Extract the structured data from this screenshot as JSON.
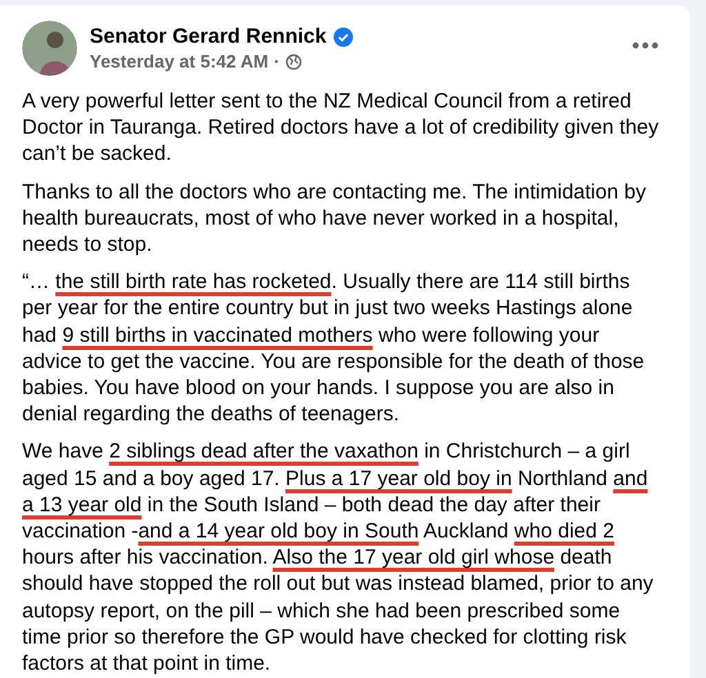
{
  "post": {
    "author": "Senator Gerard Rennick",
    "verified": true,
    "time": "Yesterday at 5:42 AM",
    "separator": "·",
    "paragraphs": [
      [
        {
          "text": "A very powerful letter sent to the NZ Medical Council from a retired Doctor in Tauranga. Retired doctors have a lot of credibility given they can’t be sacked.",
          "underlined": false
        }
      ],
      [
        {
          "text": "Thanks to all the doctors who are contacting me. The intimidation by health bureaucrats, most of who have never worked in a hospital, needs to stop.",
          "underlined": false
        }
      ],
      [
        {
          "text": "“… ",
          "underlined": false
        },
        {
          "text": "the still birth rate has rocketed",
          "underlined": true
        },
        {
          "text": ". Usually there are 114 still births per year for the entire country but in just two weeks Hastings alone had ",
          "underlined": false
        },
        {
          "text": "9 still births in vaccinated mothers",
          "underlined": true
        },
        {
          "text": " who were following your advice to get the vaccine. You are responsible for the death of those babies. You have blood on your hands. I suppose you are also in denial regarding the deaths of teenagers.",
          "underlined": false
        }
      ],
      [
        {
          "text": "We have ",
          "underlined": false
        },
        {
          "text": "2 siblings dead after the vaxathon",
          "underlined": true
        },
        {
          "text": " in Christchurch – a girl aged 15 and a boy aged 17. ",
          "underlined": false
        },
        {
          "text": "Plus a 17 year old boy in",
          "underlined": true
        },
        {
          "text": " Northland ",
          "underlined": false
        },
        {
          "text": "and a 13 year old",
          "underlined": true
        },
        {
          "text": " in the South Island – both dead the day after their vaccination -",
          "underlined": false
        },
        {
          "text": "and a 14 year old boy in South",
          "underlined": true
        },
        {
          "text": " Auckland ",
          "underlined": false
        },
        {
          "text": "who died 2",
          "underlined": true
        },
        {
          "text": " hours after his vaccination. ",
          "underlined": false
        },
        {
          "text": "Also the 17 year old girl whose",
          "underlined": true
        },
        {
          "text": " death should have stopped the roll out but was instead blamed, prior to any autopsy report, on the pill – which she had been prescribed some time prior so therefore the GP would have checked for clotting risk factors at that point in time.",
          "underlined": false
        }
      ]
    ]
  }
}
